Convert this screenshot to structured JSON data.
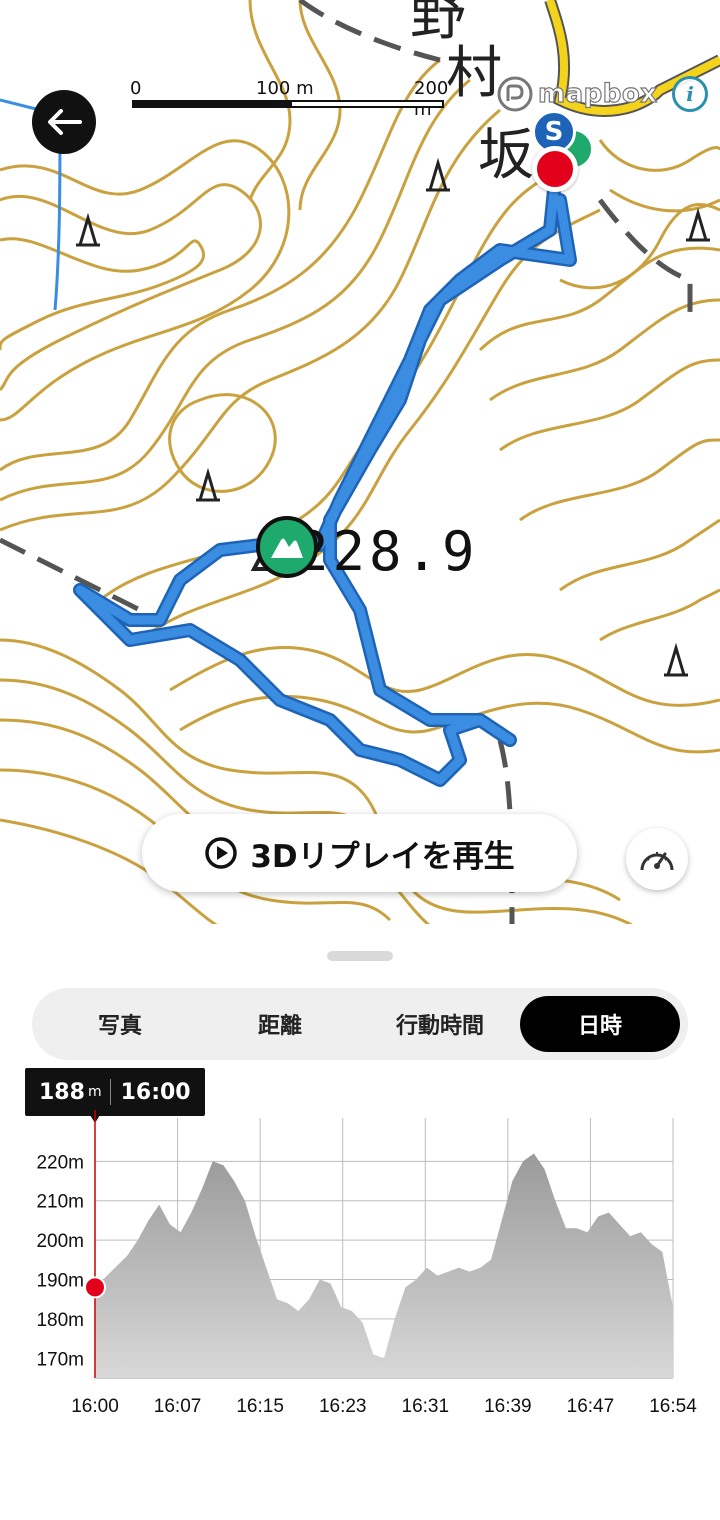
{
  "map": {
    "scale_labels": [
      "0",
      "100 m",
      "200 m"
    ],
    "attribution": "mapbox",
    "info_label": "i",
    "place_chars": [
      "野",
      "村",
      "坂"
    ],
    "summit_elevation": "228.9",
    "start_marker_label": "S",
    "route_color": "#3a8de0",
    "contour_color": "#c9a13e",
    "road_color": "#f4d41a",
    "summit_marker_color": "#1daa6c",
    "end_marker_color": "#e3001b"
  },
  "controls": {
    "back_icon": "arrow-left-icon",
    "replay_label": "3Dリプレイを再生",
    "replay_icon": "play-circle-icon",
    "speed_icon": "speedometer-icon"
  },
  "tabs": [
    {
      "label": "写真",
      "active": false
    },
    {
      "label": "距離",
      "active": false
    },
    {
      "label": "行動時間",
      "active": false
    },
    {
      "label": "日時",
      "active": true
    }
  ],
  "tooltip": {
    "elevation": "188",
    "elevation_unit": "m",
    "time": "16:00"
  },
  "chart_data": {
    "type": "area",
    "x_ticks": [
      "16:00",
      "16:07",
      "16:15",
      "16:23",
      "16:31",
      "16:39",
      "16:47",
      "16:54"
    ],
    "y_ticks": [
      "170m",
      "180m",
      "190m",
      "200m",
      "210m",
      "220m"
    ],
    "ylim": [
      165,
      231
    ],
    "xlim_minutes": [
      0,
      54
    ],
    "grid": true,
    "color": "#9e9e9e",
    "series": [
      {
        "x_minutes": [
          0,
          1.5,
          3,
          4,
          5,
          6,
          7,
          8,
          9,
          10,
          11,
          12,
          13,
          14,
          15,
          16,
          17,
          18,
          19,
          20,
          21,
          22,
          23,
          24,
          25,
          26,
          27,
          28,
          29,
          30,
          31,
          32,
          33,
          34,
          35,
          36,
          37,
          38,
          39,
          40,
          41,
          42,
          43,
          44,
          45,
          46,
          47,
          48,
          49,
          50,
          51,
          52,
          53,
          54
        ],
        "y": [
          188,
          192,
          196,
          200,
          205,
          209,
          204,
          202,
          207,
          213,
          220,
          219,
          215,
          210,
          201,
          193,
          185,
          184,
          182,
          185,
          190,
          189,
          183,
          182,
          179,
          171,
          170,
          180,
          188,
          190,
          193,
          191,
          192,
          193,
          192,
          193,
          195,
          205,
          215,
          220,
          222,
          218,
          210,
          203,
          203,
          202,
          206,
          207,
          204,
          201,
          202,
          199,
          197,
          183
        ]
      }
    ],
    "current_marker": {
      "x_minutes": 0,
      "y": 188,
      "color": "#e3001b"
    }
  }
}
